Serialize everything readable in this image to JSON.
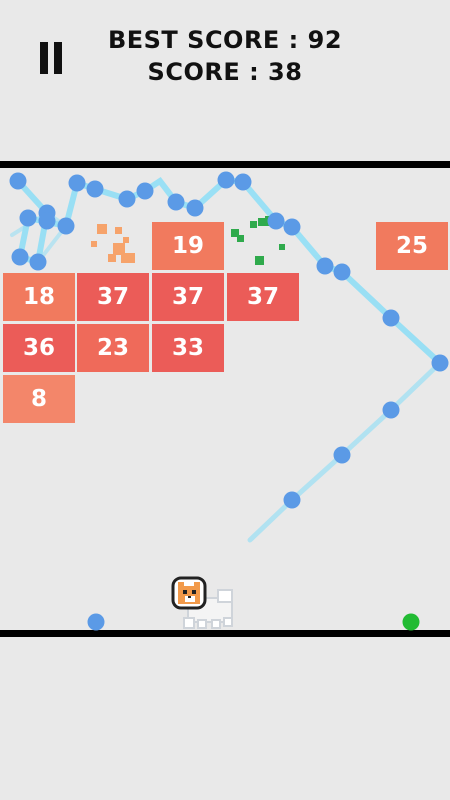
{
  "hud": {
    "best_score": "BEST SCORE : 92",
    "score": "SCORE : 38"
  },
  "bricks": [
    "19",
    "25",
    "18",
    "37",
    "37",
    "37",
    "36",
    "23",
    "33",
    "8"
  ],
  "colors": {
    "brick_light": "#f17a5e",
    "brick_dark": "#eb5c58",
    "ball": "#5b9ae6",
    "trail": "#7fdcf8",
    "launcher_ball": "#22bb33",
    "debris_orange": "#f6a36b",
    "debris_green": "#2faa4c"
  }
}
